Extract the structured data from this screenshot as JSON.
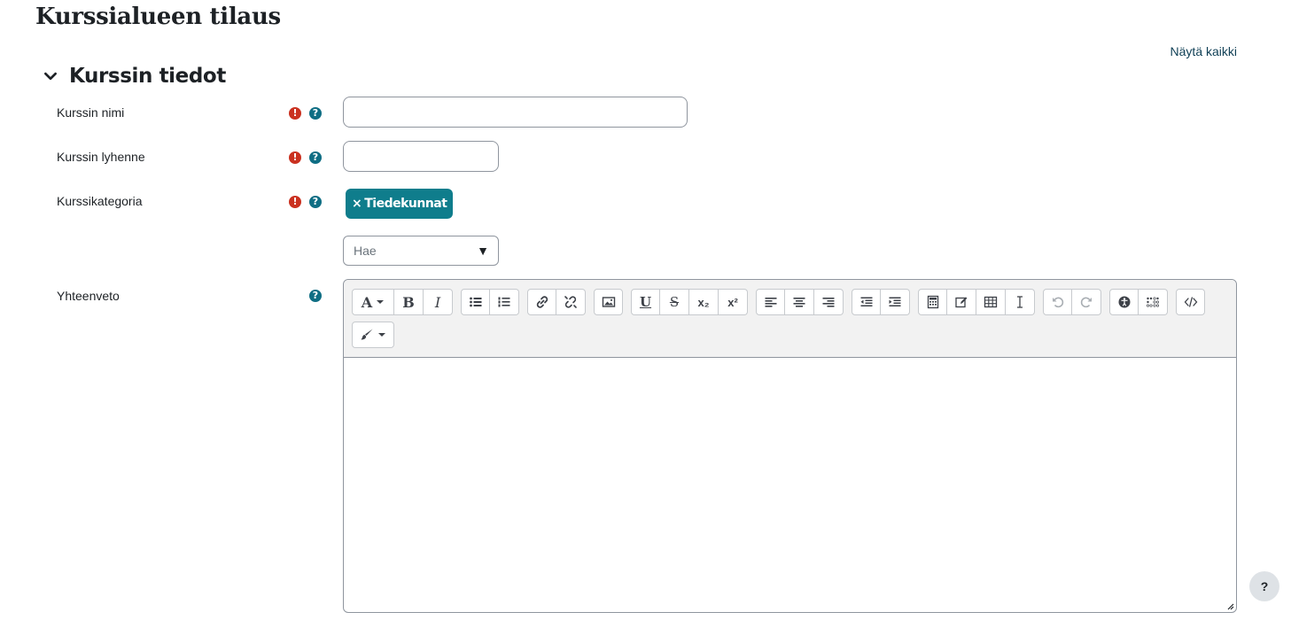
{
  "page": {
    "title": "Kurssialueen tilaus",
    "show_all_label": "Näytä kaikki"
  },
  "section": {
    "title": "Kurssin tiedot"
  },
  "fields": {
    "course_name": {
      "label": "Kurssin nimi",
      "value": ""
    },
    "course_shortname": {
      "label": "Kurssin lyhenne",
      "value": ""
    },
    "category": {
      "label": "Kurssikategoria",
      "selected_tag": "Tiedekunnat",
      "tag_remove_glyph": "×",
      "search_placeholder": "Hae"
    },
    "summary": {
      "label": "Yhteenveto"
    }
  },
  "icons": {
    "required": "exclamation-circle-icon",
    "help": "question-circle-icon",
    "required_color": "#ca3120",
    "help_color": "#0f6e84",
    "tag_color": "#0f7d8c"
  },
  "editor_toolbar": {
    "text_buttons": {
      "font": "A",
      "bold": "B",
      "italic": "I",
      "underline": "U",
      "strike": "S",
      "subscript": "x₂",
      "superscript": "x²"
    },
    "groups": [
      [
        "font-style",
        "bold",
        "italic"
      ],
      [
        "unordered-list",
        "ordered-list"
      ],
      [
        "link",
        "unlink"
      ],
      [
        "image"
      ],
      [
        "underline",
        "strikethrough",
        "subscript",
        "superscript"
      ],
      [
        "align-left",
        "align-center",
        "align-right"
      ],
      [
        "outdent",
        "indent"
      ],
      [
        "equation",
        "manage-files",
        "table",
        "clear-formatting"
      ],
      [
        "undo",
        "redo"
      ],
      [
        "accessibility-checker",
        "screenreader-helper"
      ],
      [
        "html-source"
      ],
      [
        "paint-brush"
      ]
    ]
  },
  "help_fab": {
    "label": "?"
  }
}
